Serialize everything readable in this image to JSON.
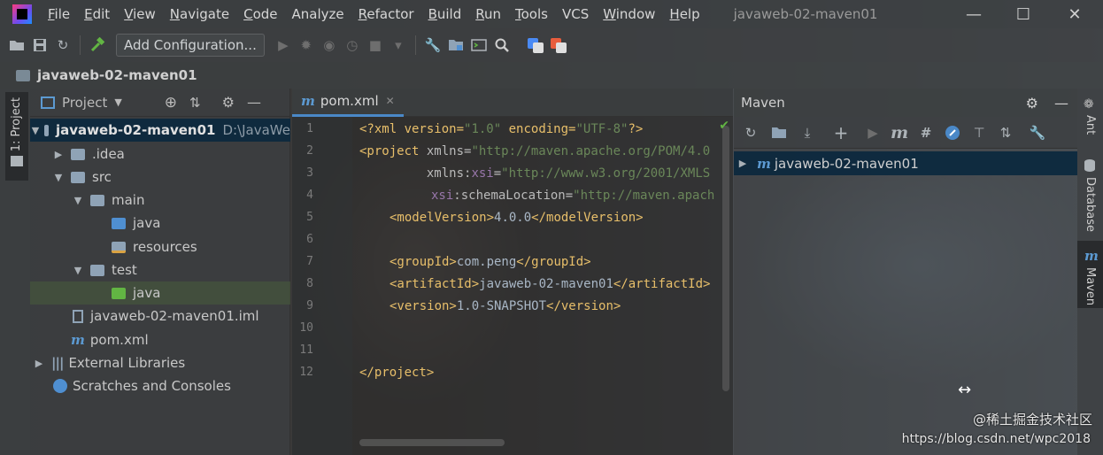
{
  "window": {
    "title": "javaweb-02-maven01",
    "menu": [
      {
        "label": "File",
        "mnemonic": "F",
        "rest": "ile"
      },
      {
        "label": "Edit",
        "mnemonic": "E",
        "rest": "dit"
      },
      {
        "label": "View",
        "mnemonic": "V",
        "rest": "iew"
      },
      {
        "label": "Navigate",
        "mnemonic": "N",
        "rest": "avigate"
      },
      {
        "label": "Code",
        "mnemonic": "C",
        "rest": "ode"
      },
      {
        "label": "Analyze",
        "mnemonic": "",
        "rest": "Analyze"
      },
      {
        "label": "Refactor",
        "mnemonic": "R",
        "rest": "efactor"
      },
      {
        "label": "Build",
        "mnemonic": "B",
        "rest": "uild"
      },
      {
        "label": "Run",
        "mnemonic": "R",
        "rest": "un"
      },
      {
        "label": "Tools",
        "mnemonic": "T",
        "rest": "ools"
      },
      {
        "label": "VCS",
        "mnemonic": "",
        "rest": "VCS"
      },
      {
        "label": "Window",
        "mnemonic": "W",
        "rest": "indow"
      },
      {
        "label": "Help",
        "mnemonic": "H",
        "rest": "elp"
      }
    ]
  },
  "toolbar": {
    "config_label": "Add Configuration..."
  },
  "breadcrumb": {
    "project": "javaweb-02-maven01"
  },
  "left_stripe": {
    "project_tab": "1: Project"
  },
  "project_panel": {
    "title": "Project",
    "tree": [
      {
        "label": "javaweb-02-maven01",
        "path": "D:\\JavaWe"
      },
      {
        "label": ".idea"
      },
      {
        "label": "src"
      },
      {
        "label": "main"
      },
      {
        "label": "java"
      },
      {
        "label": "resources"
      },
      {
        "label": "test"
      },
      {
        "label": "java"
      },
      {
        "label": "javaweb-02-maven01.iml"
      },
      {
        "label": "pom.xml"
      },
      {
        "label": "External Libraries"
      },
      {
        "label": "Scratches and Consoles"
      }
    ]
  },
  "editor": {
    "tab_label": "pom.xml",
    "lines": [
      {
        "n": "1"
      },
      {
        "n": "2"
      },
      {
        "n": "3"
      },
      {
        "n": "4"
      },
      {
        "n": "5"
      },
      {
        "n": "6"
      },
      {
        "n": "7"
      },
      {
        "n": "8"
      },
      {
        "n": "9"
      },
      {
        "n": "10"
      },
      {
        "n": "11"
      },
      {
        "n": "12"
      }
    ],
    "code": {
      "l1_a": "<?xml version=",
      "l1_b": "\"1.0\"",
      "l1_c": " encoding=",
      "l1_d": "\"UTF-8\"",
      "l1_e": "?>",
      "l2_tag": "<project",
      "l2_attr": " xmlns=",
      "l2_val": "\"http://maven.apache.org/POM/4.0",
      "l3_indent": "         xmlns:",
      "l3_ns": "xsi",
      "l3_eq": "=",
      "l3_val": "\"http://www.w3.org/2001/XMLS",
      "l4_ns": "xsi",
      "l4_attr": ":schemaLocation=",
      "l4_val": "\"http://maven.apach",
      "l5_open": "<modelVersion>",
      "l5_text": "4.0.0",
      "l5_close": "</modelVersion>",
      "l7_open": "<groupId>",
      "l7_text": "com.peng",
      "l7_close": "</groupId>",
      "l8_open": "<artifactId>",
      "l8_text": "javaweb-02-maven01",
      "l8_close": "</artifactId>",
      "l9_open": "<version>",
      "l9_text": "1.0-SNAPSHOT",
      "l9_close": "</version>",
      "l12": "</project>"
    }
  },
  "maven_panel": {
    "title": "Maven",
    "project": "javaweb-02-maven01"
  },
  "right_stripe": {
    "ant": "Ant",
    "database": "Database",
    "maven": "Maven"
  },
  "watermark": "https://blog.csdn.net/wpc2018",
  "watermark2": "@稀土掘金技术社区",
  "colors": {
    "selection": "#0d293e",
    "tag": "#e8bf6a",
    "string": "#6a8759",
    "namespace": "#9876aa"
  }
}
